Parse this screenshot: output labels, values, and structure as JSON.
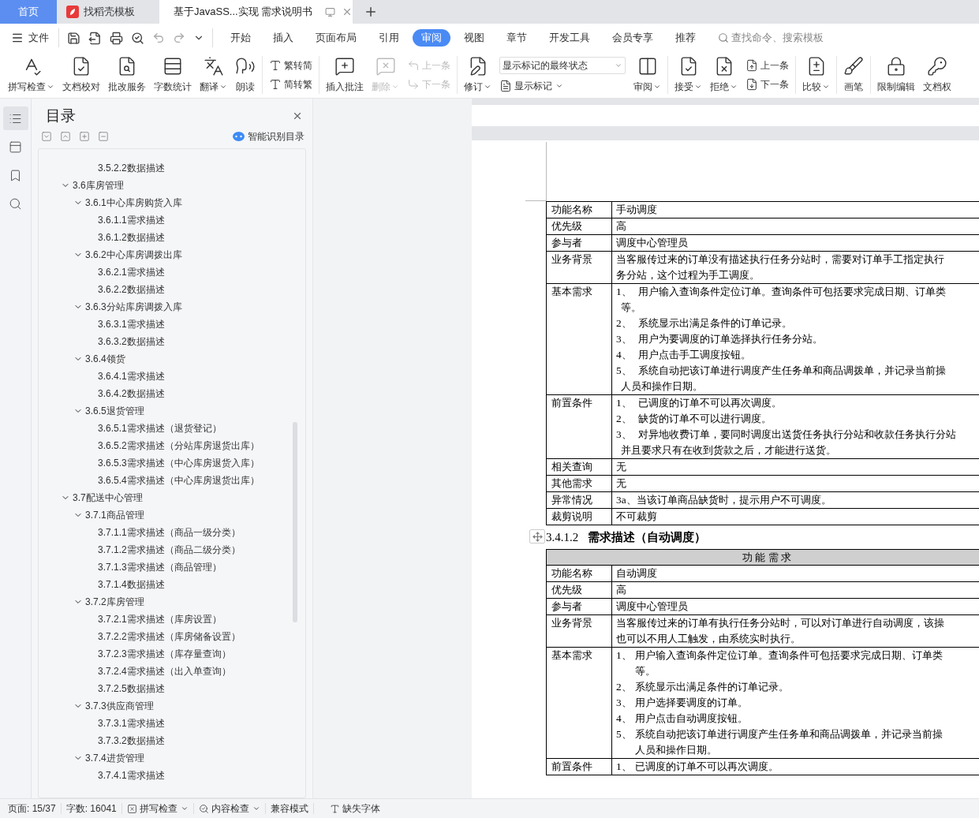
{
  "tabs": [
    {
      "kind": "home",
      "label": "首页",
      "selected": false
    },
    {
      "kind": "template",
      "label": "找稻壳模板",
      "selected": false
    },
    {
      "kind": "document",
      "label": "基于JavaSS...实现 需求说明书",
      "selected": true
    }
  ],
  "menu": {
    "file": "文件",
    "tabs": [
      {
        "label": "开始",
        "selected": false
      },
      {
        "label": "插入",
        "selected": false
      },
      {
        "label": "页面布局",
        "selected": false
      },
      {
        "label": "引用",
        "selected": false
      },
      {
        "label": "审阅",
        "selected": true
      },
      {
        "label": "视图",
        "selected": false
      },
      {
        "label": "章节",
        "selected": false
      },
      {
        "label": "开发工具",
        "selected": false
      },
      {
        "label": "会员专享",
        "selected": false
      },
      {
        "label": "推荐",
        "selected": false
      }
    ],
    "search": {
      "placeholder": "查找命令、搜索模板"
    }
  },
  "ribbon": {
    "groups": [
      {
        "items": [
          {
            "kind": "large",
            "label": "拼写检查",
            "dropdown": true,
            "disabled": false
          },
          {
            "kind": "large",
            "label": "文档校对",
            "dropdown": false,
            "disabled": false
          },
          {
            "kind": "large",
            "label": "批改服务",
            "dropdown": false,
            "disabled": false
          },
          {
            "kind": "large",
            "label": "字数统计",
            "dropdown": false,
            "disabled": false
          },
          {
            "kind": "large",
            "label": "翻译",
            "dropdown": true,
            "disabled": false
          },
          {
            "kind": "large",
            "label": "朗读",
            "dropdown": false,
            "disabled": false
          }
        ]
      },
      {
        "items": [
          {
            "kind": "stack",
            "entries": [
              {
                "kind": "button",
                "label": "繁转简",
                "dropdown": false,
                "disabled": false
              },
              {
                "kind": "button",
                "label": "简转繁",
                "dropdown": false,
                "disabled": false
              }
            ]
          }
        ]
      },
      {
        "items": [
          {
            "kind": "large",
            "label": "插入批注",
            "dropdown": false,
            "disabled": false
          },
          {
            "kind": "large",
            "label": "删除",
            "dropdown": true,
            "disabled": true
          },
          {
            "kind": "stack",
            "entries": [
              {
                "kind": "button",
                "label": "上一条",
                "dropdown": false,
                "disabled": true
              },
              {
                "kind": "button",
                "label": "下一条",
                "dropdown": false,
                "disabled": true
              }
            ]
          }
        ]
      },
      {
        "items": [
          {
            "kind": "large",
            "label": "修订",
            "dropdown": true,
            "disabled": false
          },
          {
            "kind": "stack",
            "entries": [
              {
                "kind": "select",
                "value": "显示标记的最终状态"
              },
              {
                "kind": "button",
                "label": "显示标记",
                "dropdown": true,
                "disabled": false
              }
            ]
          },
          {
            "kind": "large",
            "label": "审阅",
            "dropdown": true,
            "disabled": false
          }
        ]
      },
      {
        "items": [
          {
            "kind": "large",
            "label": "接受",
            "dropdown": true,
            "disabled": false
          },
          {
            "kind": "large",
            "label": "拒绝",
            "dropdown": true,
            "disabled": false
          },
          {
            "kind": "stack",
            "entries": [
              {
                "kind": "button",
                "label": "上一条",
                "dropdown": false,
                "disabled": false
              },
              {
                "kind": "button",
                "label": "下一条",
                "dropdown": false,
                "disabled": false
              }
            ]
          }
        ]
      },
      {
        "items": [
          {
            "kind": "large",
            "label": "比较",
            "dropdown": true,
            "disabled": false
          }
        ]
      },
      {
        "items": [
          {
            "kind": "large",
            "label": "画笔",
            "dropdown": false,
            "disabled": false
          }
        ]
      },
      {
        "items": [
          {
            "kind": "large",
            "label": "限制编辑",
            "dropdown": false,
            "disabled": false
          },
          {
            "kind": "large",
            "label": "文档权",
            "dropdown": false,
            "disabled": false
          }
        ]
      }
    ]
  },
  "rail": [
    {
      "selected": true
    },
    {
      "selected": false
    },
    {
      "selected": false
    },
    {
      "selected": false
    }
  ],
  "toc": {
    "title": "目录",
    "smart_button": "智能识别目录",
    "leading_items": [
      "3.5.2.2数据描述"
    ],
    "items": [
      {
        "label": "3.6库房管理",
        "expanded": true,
        "children": [
          {
            "label": "3.6.1中心库房购货入库",
            "expanded": true,
            "children": [
              {
                "label": "3.6.1.1需求描述"
              },
              {
                "label": "3.6.1.2数据描述"
              }
            ]
          },
          {
            "label": "3.6.2中心库房调拨出库",
            "expanded": true,
            "children": [
              {
                "label": "3.6.2.1需求描述"
              },
              {
                "label": "3.6.2.2数据描述"
              }
            ]
          },
          {
            "label": "3.6.3分站库房调拨入库",
            "expanded": true,
            "children": [
              {
                "label": "3.6.3.1需求描述"
              },
              {
                "label": "3.6.3.2数据描述"
              }
            ]
          },
          {
            "label": "3.6.4领货",
            "expanded": true,
            "children": [
              {
                "label": "3.6.4.1需求描述"
              },
              {
                "label": "3.6.4.2数据描述"
              }
            ]
          },
          {
            "label": "3.6.5退货管理",
            "expanded": true,
            "children": [
              {
                "label": "3.6.5.1需求描述（退货登记）"
              },
              {
                "label": "3.6.5.2需求描述（分站库房退货出库）"
              },
              {
                "label": "3.6.5.3需求描述（中心库房退货入库）"
              },
              {
                "label": "3.6.5.4需求描述（中心库房退货出库）"
              }
            ]
          }
        ]
      },
      {
        "label": "3.7配送中心管理",
        "expanded": true,
        "children": [
          {
            "label": "3.7.1商品管理",
            "expanded": true,
            "children": [
              {
                "label": "3.7.1.1需求描述（商品一级分类）"
              },
              {
                "label": "3.7.1.2需求描述（商品二级分类）"
              },
              {
                "label": "3.7.1.3需求描述（商品管理）"
              },
              {
                "label": "3.7.1.4数据描述"
              }
            ]
          },
          {
            "label": "3.7.2库房管理",
            "expanded": true,
            "children": [
              {
                "label": "3.7.2.1需求描述（库房设置）"
              },
              {
                "label": "3.7.2.2需求描述（库房储备设置）"
              },
              {
                "label": "3.7.2.3需求描述（库存量查询）"
              },
              {
                "label": "3.7.2.4需求描述（出入单查询）"
              },
              {
                "label": "3.7.2.5数据描述"
              }
            ]
          },
          {
            "label": "3.7.3供应商管理",
            "expanded": true,
            "children": [
              {
                "label": "3.7.3.1需求描述"
              },
              {
                "label": "3.7.3.2数据描述"
              }
            ]
          },
          {
            "label": "3.7.4进货管理",
            "expanded": true,
            "children": [
              {
                "label": "3.7.4.1需求描述"
              }
            ]
          }
        ]
      }
    ]
  },
  "document": {
    "blocks": [
      {
        "kind": "table",
        "hanging_indent": false,
        "rows": [
          {
            "kind": "text",
            "label": "功能名称",
            "lines": [
              "手动调度"
            ]
          },
          {
            "kind": "text",
            "label": "优先级",
            "lines": [
              "高"
            ]
          },
          {
            "kind": "text",
            "label": "参与者",
            "lines": [
              "调度中心管理员"
            ]
          },
          {
            "kind": "text",
            "label": "业务背景",
            "lines": [
              "当客服传过来的订单没有描述执行任务分站时，需要对订单手工指定执行",
              "务分站，这个过程为手工调度。"
            ]
          },
          {
            "kind": "list",
            "label": "基本需求",
            "items": [
              {
                "number": "1、",
                "lines": [
                  "用户输入查询条件定位订单。查询条件可包括要求完成日期、订单类",
                  "等。"
                ]
              },
              {
                "number": "2、",
                "lines": [
                  "系统显示出满足条件的订单记录。"
                ]
              },
              {
                "number": "3、",
                "lines": [
                  "用户为要调度的订单选择执行任务分站。"
                ]
              },
              {
                "number": "4、",
                "lines": [
                  "用户点击手工调度按钮。"
                ]
              },
              {
                "number": "5、",
                "lines": [
                  "系统自动把该订单进行调度产生任务单和商品调拨单，并记录当前操",
                  "人员和操作日期。"
                ]
              }
            ]
          },
          {
            "kind": "list",
            "label": "前置条件",
            "items": [
              {
                "number": "1、",
                "lines": [
                  "已调度的订单不可以再次调度。"
                ]
              },
              {
                "number": "2、",
                "lines": [
                  "缺货的订单不可以进行调度。"
                ]
              },
              {
                "number": "3、",
                "lines": [
                  "对异地收费订单，要同时调度出送货任务执行分站和收款任务执行分站",
                  "并且要求只有在收到货款之后，才能进行送货。"
                ]
              }
            ]
          },
          {
            "kind": "text",
            "label": "相关查询",
            "lines": [
              "无"
            ]
          },
          {
            "kind": "text",
            "label": "其他需求",
            "lines": [
              "无"
            ]
          },
          {
            "kind": "text",
            "label": "异常情况",
            "lines": [
              "3a、当该订单商品缺货时，提示用户不可调度。"
            ]
          },
          {
            "kind": "text",
            "label": "裁剪说明",
            "lines": [
              "不可裁剪"
            ]
          }
        ]
      },
      {
        "kind": "heading",
        "number": "3.4.1.2",
        "title": "需求描述（自动调度）"
      },
      {
        "kind": "table",
        "hanging_indent": true,
        "header": "功 能 需 求",
        "rows": [
          {
            "kind": "text",
            "label": "功能名称",
            "lines": [
              "自动调度"
            ]
          },
          {
            "kind": "text",
            "label": "优先级",
            "lines": [
              "高"
            ]
          },
          {
            "kind": "text",
            "label": "参与者",
            "lines": [
              "调度中心管理员"
            ]
          },
          {
            "kind": "text",
            "label": "业务背景",
            "lines": [
              "当客服传过来的订单有执行任务分站时，可以对订单进行自动调度，该操",
              "也可以不用人工触发，由系统实时执行。"
            ]
          },
          {
            "kind": "list",
            "label": "基本需求",
            "items": [
              {
                "number": "1、",
                "lines": [
                  "用户输入查询条件定位订单。查询条件可包括要求完成日期、订单类",
                  "等。"
                ]
              },
              {
                "number": "2、",
                "lines": [
                  "系统显示出满足条件的订单记录。"
                ]
              },
              {
                "number": "3、",
                "lines": [
                  "用户选择要调度的订单。"
                ]
              },
              {
                "number": "4、",
                "lines": [
                  "用户点击自动调度按钮。"
                ]
              },
              {
                "number": "5、",
                "lines": [
                  "系统自动把该订单进行调度产生任务单和商品调拨单，并记录当前操",
                  "人员和操作日期。"
                ]
              }
            ]
          },
          {
            "kind": "list",
            "label": "前置条件",
            "items": [
              {
                "number": "1、",
                "lines": [
                  "已调度的订单不可以再次调度。"
                ]
              }
            ]
          }
        ]
      }
    ]
  },
  "status_bar": [
    {
      "kind": "text",
      "label": "页面: 15/37"
    },
    {
      "kind": "text",
      "label": "字数: 16041"
    },
    {
      "kind": "spell",
      "label": "拼写检查",
      "dropdown": true
    },
    {
      "kind": "content",
      "label": "内容检查",
      "dropdown": true
    },
    {
      "kind": "text",
      "label": "兼容模式"
    },
    {
      "kind": "font",
      "label": "缺失字体",
      "dropdown": false
    }
  ]
}
